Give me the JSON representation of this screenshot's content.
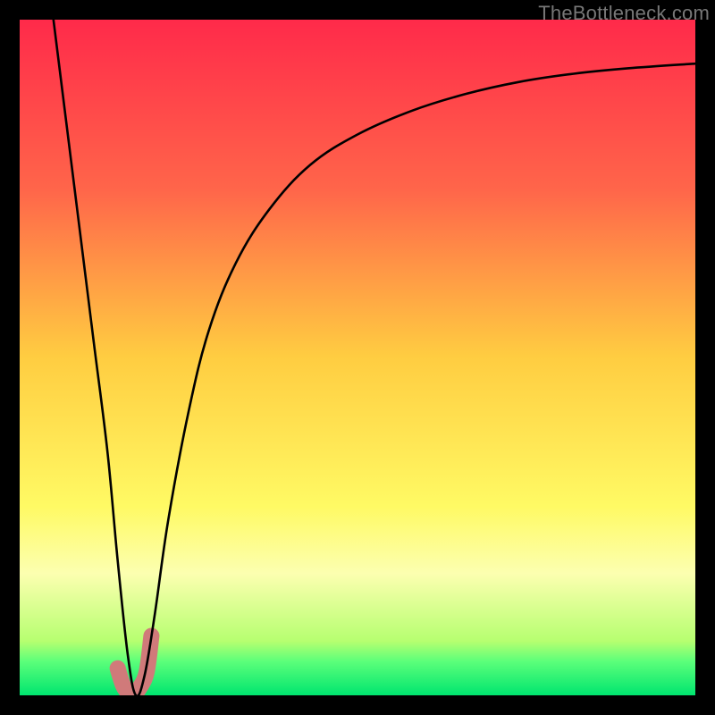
{
  "watermark": {
    "text": "TheBottleneck.com"
  },
  "chart_data": {
    "type": "line",
    "title": "",
    "xlabel": "",
    "ylabel": "",
    "xlim": [
      0,
      100
    ],
    "ylim": [
      0,
      100
    ],
    "grid": false,
    "background_gradient": {
      "stops": [
        {
          "offset": 0.0,
          "color": "#ff2a4a"
        },
        {
          "offset": 0.25,
          "color": "#ff654a"
        },
        {
          "offset": 0.5,
          "color": "#ffcd41"
        },
        {
          "offset": 0.72,
          "color": "#fffa64"
        },
        {
          "offset": 0.82,
          "color": "#fcffb0"
        },
        {
          "offset": 0.92,
          "color": "#b6ff70"
        },
        {
          "offset": 0.95,
          "color": "#5bff7a"
        },
        {
          "offset": 1.0,
          "color": "#00e56f"
        }
      ]
    },
    "series": [
      {
        "name": "curve",
        "color": "#000000",
        "stroke_width": 2.6,
        "x": [
          5,
          7,
          9,
          11,
          13,
          14.5,
          16,
          17.2,
          18.5,
          20,
          22,
          25,
          28,
          32,
          37,
          43,
          50,
          58,
          66,
          74,
          82,
          90,
          100
        ],
        "y": [
          100,
          84,
          68,
          52,
          36,
          20,
          6,
          0,
          3,
          12,
          26,
          42,
          54,
          64,
          72,
          78.5,
          83,
          86.5,
          89,
          90.8,
          92,
          92.8,
          93.5
        ]
      }
    ],
    "highlight": {
      "name": "marker-j",
      "color": "#d07a7a",
      "stroke_width": 18,
      "x": [
        14.5,
        15.3,
        16.1,
        16.9,
        17.8,
        18.8,
        19.5
      ],
      "y": [
        4.0,
        1.5,
        0.4,
        0.2,
        1.2,
        3.5,
        8.8
      ]
    }
  }
}
